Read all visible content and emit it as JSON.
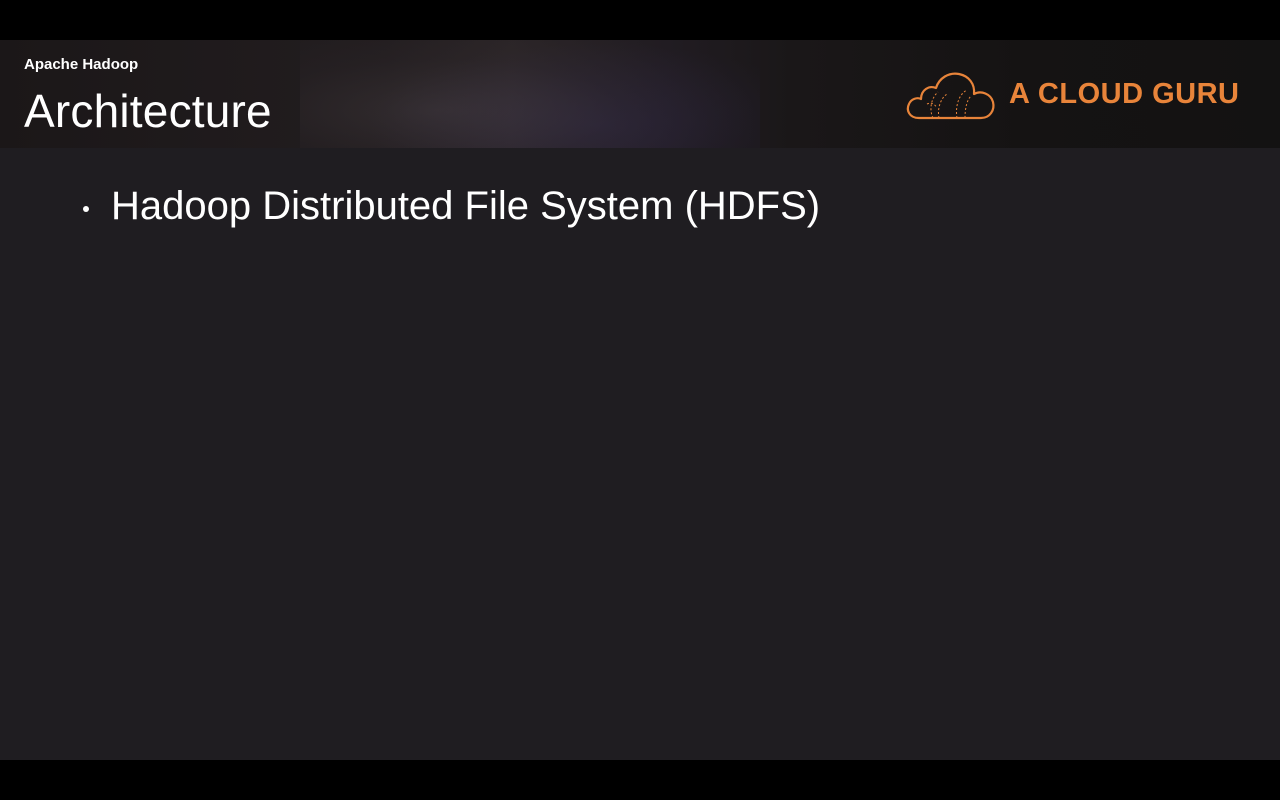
{
  "slide": {
    "subtitle": "Apache Hadoop",
    "title": "Architecture",
    "bullets": [
      "Hadoop Distributed File System (HDFS)"
    ]
  },
  "logo": {
    "icon": "cloud-logo-icon",
    "text": "A CLOUD GURU",
    "color": "#e8843a"
  },
  "colors": {
    "slide_background": "#1f1d21",
    "header_background": "#1a1718",
    "text": "#ffffff"
  }
}
